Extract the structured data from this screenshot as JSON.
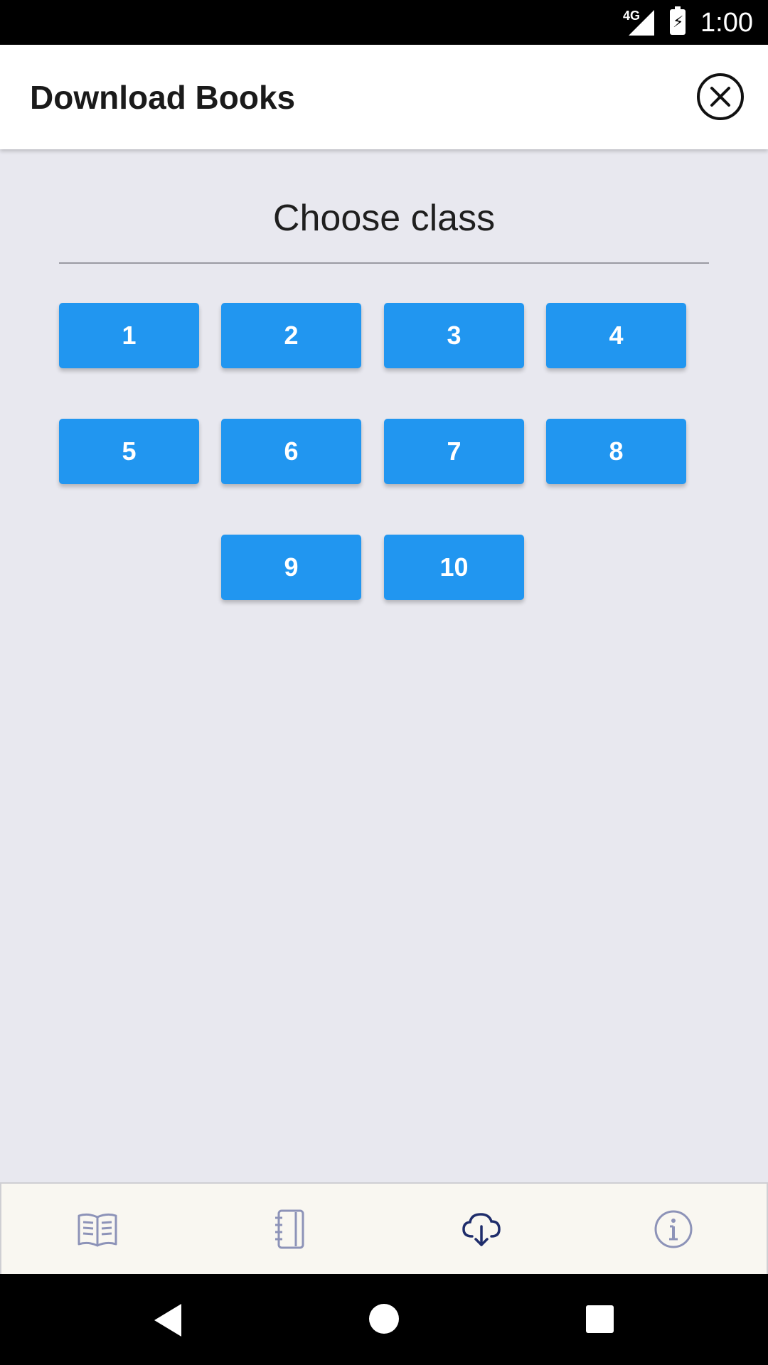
{
  "status_bar": {
    "network": "4G",
    "time": "1:00",
    "icons": [
      "signal-icon",
      "battery-charging-icon"
    ]
  },
  "header": {
    "title": "Download Books",
    "close_icon": "close-circle-icon"
  },
  "section": {
    "title": "Choose class"
  },
  "classes": [
    "1",
    "2",
    "3",
    "4",
    "5",
    "6",
    "7",
    "8",
    "9",
    "10"
  ],
  "bottom_nav": {
    "items": [
      {
        "icon": "open-book-icon",
        "active": false
      },
      {
        "icon": "notebook-icon",
        "active": false
      },
      {
        "icon": "cloud-download-icon",
        "active": true
      },
      {
        "icon": "info-icon",
        "active": false
      }
    ],
    "colors": {
      "active": "#1f2d6b",
      "inactive": "#8d93b8"
    }
  },
  "system_nav": {
    "icons": [
      "back-icon",
      "home-icon",
      "recents-icon"
    ]
  },
  "colors": {
    "background": "#e8e8ef",
    "button": "#2196f0",
    "header_bg": "#ffffff",
    "nav_bg": "#f9f7f1"
  }
}
